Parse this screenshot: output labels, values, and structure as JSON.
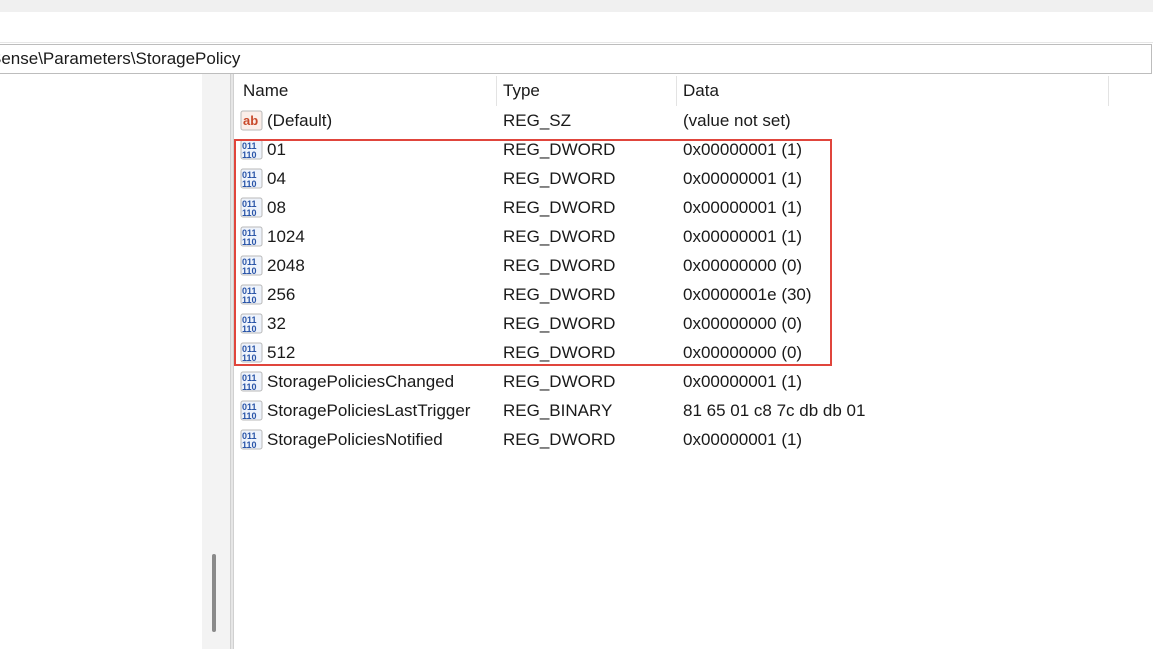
{
  "address_bar": {
    "path": "Sense\\Parameters\\StoragePolicy"
  },
  "columns": {
    "name": "Name",
    "type": "Type",
    "data": "Data"
  },
  "rows": [
    {
      "name": "(Default)",
      "type": "REG_SZ",
      "data": "(value not set)",
      "icon": "string-value-icon"
    },
    {
      "name": "01",
      "type": "REG_DWORD",
      "data": "0x00000001 (1)",
      "icon": "binary-value-icon"
    },
    {
      "name": "04",
      "type": "REG_DWORD",
      "data": "0x00000001 (1)",
      "icon": "binary-value-icon"
    },
    {
      "name": "08",
      "type": "REG_DWORD",
      "data": "0x00000001 (1)",
      "icon": "binary-value-icon"
    },
    {
      "name": "1024",
      "type": "REG_DWORD",
      "data": "0x00000001 (1)",
      "icon": "binary-value-icon"
    },
    {
      "name": "2048",
      "type": "REG_DWORD",
      "data": "0x00000000 (0)",
      "icon": "binary-value-icon"
    },
    {
      "name": "256",
      "type": "REG_DWORD",
      "data": "0x0000001e (30)",
      "icon": "binary-value-icon"
    },
    {
      "name": "32",
      "type": "REG_DWORD",
      "data": "0x00000000 (0)",
      "icon": "binary-value-icon"
    },
    {
      "name": "512",
      "type": "REG_DWORD",
      "data": "0x00000000 (0)",
      "icon": "binary-value-icon"
    },
    {
      "name": "StoragePoliciesChanged",
      "type": "REG_DWORD",
      "data": "0x00000001 (1)",
      "icon": "binary-value-icon"
    },
    {
      "name": "StoragePoliciesLastTrigger",
      "type": "REG_BINARY",
      "data": "81 65 01 c8 7c db db 01",
      "icon": "binary-value-icon"
    },
    {
      "name": "StoragePoliciesNotified",
      "type": "REG_DWORD",
      "data": "0x00000001 (1)",
      "icon": "binary-value-icon"
    }
  ],
  "colors": {
    "highlight_border": "#e0453c",
    "string_icon": "#c8492a",
    "binary_icon": "#2a55a8"
  }
}
